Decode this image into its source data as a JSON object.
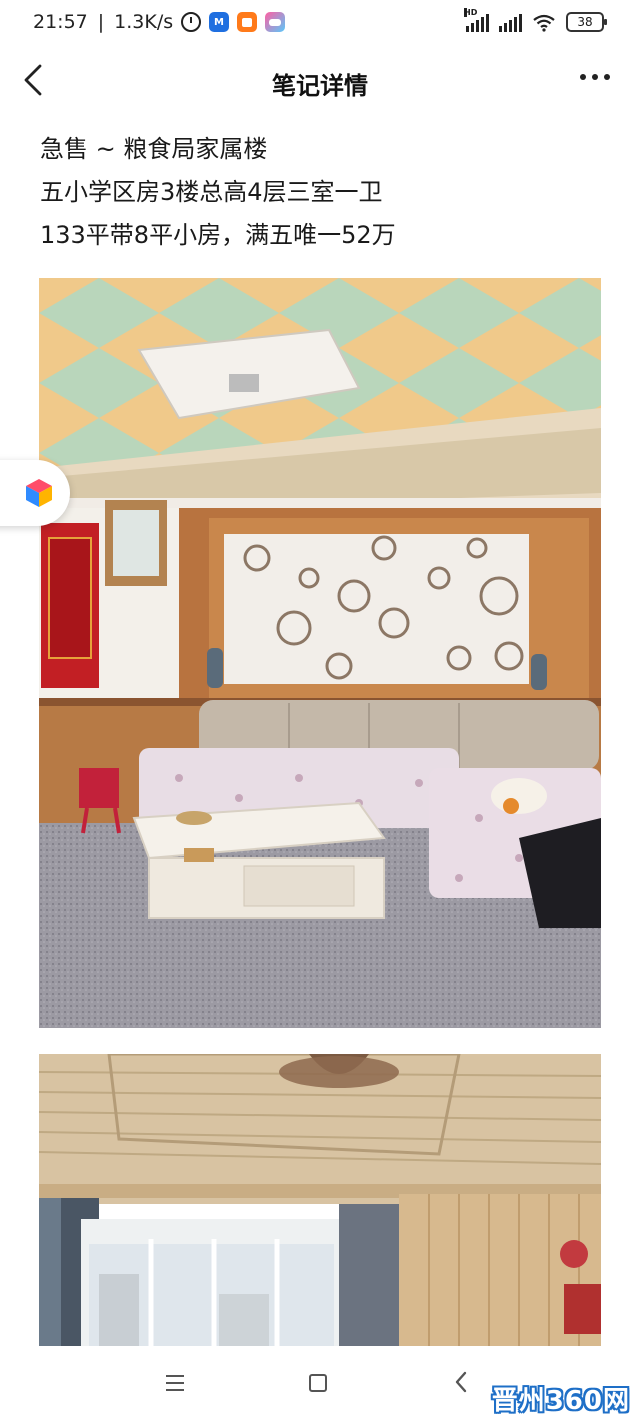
{
  "status_bar": {
    "time": "21:57",
    "network_speed": "1.3K/s",
    "battery": "38",
    "hd_label": "HD",
    "icons": [
      "alarm-icon",
      "meituan-app-icon",
      "taobao-app-icon",
      "game-app-icon",
      "signal-icon",
      "wifi-icon",
      "battery-icon"
    ]
  },
  "nav": {
    "title": "笔记详情",
    "back_icon": "back-arrow-icon",
    "more_icon": "more-dots-icon"
  },
  "post": {
    "lines": [
      "急售 ~ 粮食局家属楼",
      "五小学区房3楼总高4层三室一卫",
      "133平带8平小房，满五唯一52万"
    ]
  },
  "photos": [
    {
      "subject": "living-room-sofa"
    },
    {
      "subject": "living-room-window"
    }
  ],
  "float_badge": {
    "icon": "cube-app-icon"
  },
  "bottom_nav": {
    "icons": [
      "menu-icon",
      "home-square-icon",
      "back-chevron-icon"
    ],
    "watermark": "晋州360网"
  },
  "colors": {
    "background": "#ffffff",
    "text": "#1a1a1a",
    "watermark_blue": "#1e6fc7"
  }
}
